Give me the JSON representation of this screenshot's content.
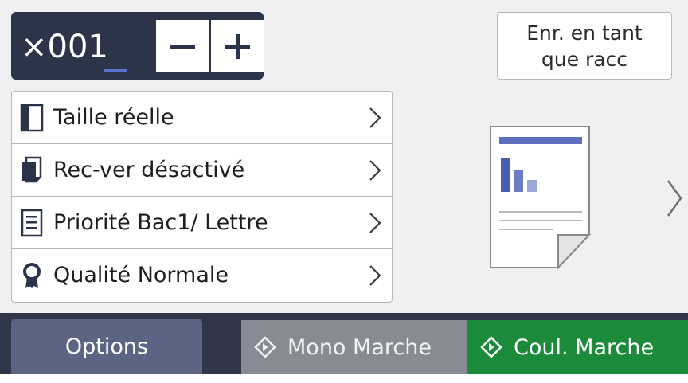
{
  "copy_counter": {
    "prefix": "×00",
    "cursor_digit": "1",
    "decrease_label": "−",
    "increase_label": "+"
  },
  "shortcut": {
    "line1": "Enr. en tant",
    "line2": "que racc"
  },
  "settings": [
    {
      "label": "Taille réelle",
      "icon": "page-icon"
    },
    {
      "label": "Rec-ver désactivé",
      "icon": "duplex-icon"
    },
    {
      "label": "Priorité Bac1/ Lettre",
      "icon": "tray-icon"
    },
    {
      "label": "Qualité Normale",
      "icon": "quality-ribbon-icon"
    }
  ],
  "preview": {
    "icon": "document-preview-icon"
  },
  "bottom_bar": {
    "options_label": "Options",
    "mono_label": "Mono Marche",
    "colour_label": "Coul. Marche"
  },
  "colors": {
    "dark_panel": "#2b3448",
    "options_button": "#5b6583",
    "mono_button": "#888b93",
    "colour_button": "#1b8a3a",
    "preview_accent": "#5d6fbe"
  }
}
